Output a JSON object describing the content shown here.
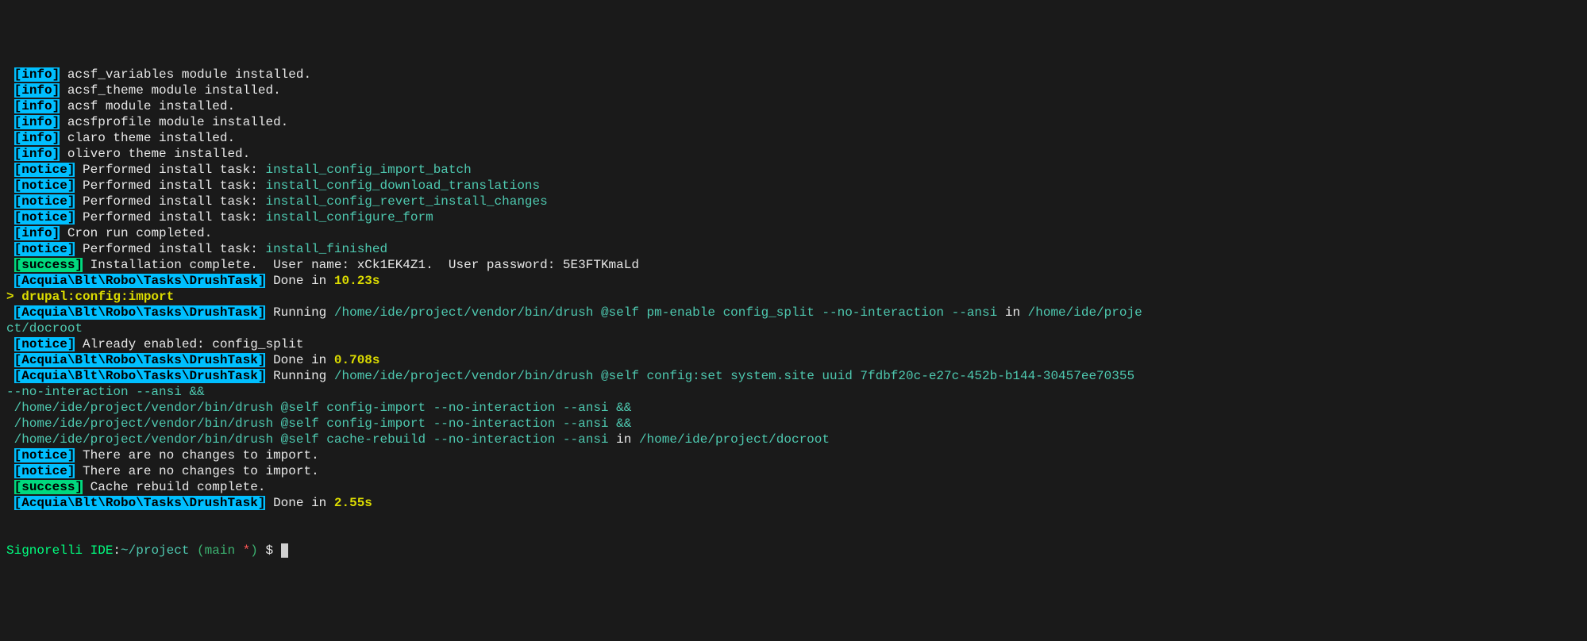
{
  "lines": [
    {
      "parts": [
        {
          "cls": "white",
          "text": " "
        },
        {
          "cls": "tag-info",
          "text": "[info]"
        },
        {
          "cls": "white",
          "text": " acsf_variables module installed."
        }
      ]
    },
    {
      "parts": [
        {
          "cls": "white",
          "text": " "
        },
        {
          "cls": "tag-info",
          "text": "[info]"
        },
        {
          "cls": "white",
          "text": " acsf_theme module installed."
        }
      ]
    },
    {
      "parts": [
        {
          "cls": "white",
          "text": " "
        },
        {
          "cls": "tag-info",
          "text": "[info]"
        },
        {
          "cls": "white",
          "text": " acsf module installed."
        }
      ]
    },
    {
      "parts": [
        {
          "cls": "white",
          "text": " "
        },
        {
          "cls": "tag-info",
          "text": "[info]"
        },
        {
          "cls": "white",
          "text": " acsfprofile module installed."
        }
      ]
    },
    {
      "parts": [
        {
          "cls": "white",
          "text": " "
        },
        {
          "cls": "tag-info",
          "text": "[info]"
        },
        {
          "cls": "white",
          "text": " claro theme installed."
        }
      ]
    },
    {
      "parts": [
        {
          "cls": "white",
          "text": " "
        },
        {
          "cls": "tag-info",
          "text": "[info]"
        },
        {
          "cls": "white",
          "text": " olivero theme installed."
        }
      ]
    },
    {
      "parts": [
        {
          "cls": "white",
          "text": " "
        },
        {
          "cls": "tag-notice",
          "text": "[notice]"
        },
        {
          "cls": "white",
          "text": " Performed install task: "
        },
        {
          "cls": "teal",
          "text": "install_config_import_batch"
        }
      ]
    },
    {
      "parts": [
        {
          "cls": "white",
          "text": " "
        },
        {
          "cls": "tag-notice",
          "text": "[notice]"
        },
        {
          "cls": "white",
          "text": " Performed install task: "
        },
        {
          "cls": "teal",
          "text": "install_config_download_translations"
        }
      ]
    },
    {
      "parts": [
        {
          "cls": "white",
          "text": " "
        },
        {
          "cls": "tag-notice",
          "text": "[notice]"
        },
        {
          "cls": "white",
          "text": " Performed install task: "
        },
        {
          "cls": "teal",
          "text": "install_config_revert_install_changes"
        }
      ]
    },
    {
      "parts": [
        {
          "cls": "white",
          "text": " "
        },
        {
          "cls": "tag-notice",
          "text": "[notice]"
        },
        {
          "cls": "white",
          "text": " Performed install task: "
        },
        {
          "cls": "teal",
          "text": "install_configure_form"
        }
      ]
    },
    {
      "parts": [
        {
          "cls": "white",
          "text": " "
        },
        {
          "cls": "tag-info",
          "text": "[info]"
        },
        {
          "cls": "white",
          "text": " Cron run completed."
        }
      ]
    },
    {
      "parts": [
        {
          "cls": "white",
          "text": " "
        },
        {
          "cls": "tag-notice",
          "text": "[notice]"
        },
        {
          "cls": "white",
          "text": " Performed install task: "
        },
        {
          "cls": "teal",
          "text": "install_finished"
        }
      ]
    },
    {
      "parts": [
        {
          "cls": "white",
          "text": " "
        },
        {
          "cls": "tag-success",
          "text": "[success]"
        },
        {
          "cls": "white",
          "text": " Installation complete.  User name: xCk1EK4Z1.  User password: 5E3FTKmaLd"
        }
      ]
    },
    {
      "parts": [
        {
          "cls": "white",
          "text": " "
        },
        {
          "cls": "tag-drush",
          "text": "[Acquia\\Blt\\Robo\\Tasks\\DrushTask]"
        },
        {
          "cls": "white",
          "text": " Done in "
        },
        {
          "cls": "yellow",
          "text": "10.23s"
        }
      ]
    },
    {
      "parts": [
        {
          "cls": "prompt-y",
          "text": "> drupal:config:import"
        }
      ]
    },
    {
      "parts": [
        {
          "cls": "white",
          "text": " "
        },
        {
          "cls": "tag-drush",
          "text": "[Acquia\\Blt\\Robo\\Tasks\\DrushTask]"
        },
        {
          "cls": "white",
          "text": " Running "
        },
        {
          "cls": "teal",
          "text": "/home/ide/project/vendor/bin/drush @self pm-enable config_split --no-interaction --ansi"
        },
        {
          "cls": "white",
          "text": " in "
        },
        {
          "cls": "teal",
          "text": "/home/ide/proje"
        }
      ]
    },
    {
      "parts": [
        {
          "cls": "teal",
          "text": "ct/docroot"
        }
      ]
    },
    {
      "parts": [
        {
          "cls": "white",
          "text": " "
        },
        {
          "cls": "tag-notice",
          "text": "[notice]"
        },
        {
          "cls": "white",
          "text": " Already enabled: config_split"
        }
      ]
    },
    {
      "parts": [
        {
          "cls": "white",
          "text": " "
        },
        {
          "cls": "tag-drush",
          "text": "[Acquia\\Blt\\Robo\\Tasks\\DrushTask]"
        },
        {
          "cls": "white",
          "text": " Done in "
        },
        {
          "cls": "yellow",
          "text": "0.708s"
        }
      ]
    },
    {
      "parts": [
        {
          "cls": "white",
          "text": " "
        },
        {
          "cls": "tag-drush",
          "text": "[Acquia\\Blt\\Robo\\Tasks\\DrushTask]"
        },
        {
          "cls": "white",
          "text": " Running "
        },
        {
          "cls": "teal",
          "text": "/home/ide/project/vendor/bin/drush @self config:set system.site uuid 7fdbf20c-e27c-452b-b144-30457ee70355 "
        }
      ]
    },
    {
      "parts": [
        {
          "cls": "teal",
          "text": "--no-interaction --ansi &&"
        }
      ]
    },
    {
      "parts": [
        {
          "cls": "teal",
          "text": " /home/ide/project/vendor/bin/drush @self config-import --no-interaction --ansi &&"
        }
      ]
    },
    {
      "parts": [
        {
          "cls": "teal",
          "text": " /home/ide/project/vendor/bin/drush @self config-import --no-interaction --ansi &&"
        }
      ]
    },
    {
      "parts": [
        {
          "cls": "teal",
          "text": " /home/ide/project/vendor/bin/drush @self cache-rebuild --no-interaction --ansi"
        },
        {
          "cls": "white",
          "text": " in "
        },
        {
          "cls": "teal",
          "text": "/home/ide/project/docroot"
        }
      ]
    },
    {
      "parts": [
        {
          "cls": "white",
          "text": " "
        },
        {
          "cls": "tag-notice",
          "text": "[notice]"
        },
        {
          "cls": "white",
          "text": " There are no changes to import."
        }
      ]
    },
    {
      "parts": [
        {
          "cls": "white",
          "text": " "
        },
        {
          "cls": "tag-notice",
          "text": "[notice]"
        },
        {
          "cls": "white",
          "text": " There are no changes to import."
        }
      ]
    },
    {
      "parts": [
        {
          "cls": "white",
          "text": " "
        },
        {
          "cls": "tag-success",
          "text": "[success]"
        },
        {
          "cls": "white",
          "text": " Cache rebuild complete."
        }
      ]
    },
    {
      "parts": [
        {
          "cls": "white",
          "text": " "
        },
        {
          "cls": "tag-drush",
          "text": "[Acquia\\Blt\\Robo\\Tasks\\DrushTask]"
        },
        {
          "cls": "white",
          "text": " Done in "
        },
        {
          "cls": "yellow",
          "text": "2.55s"
        }
      ]
    }
  ],
  "prompt": {
    "host": "Signorelli IDE",
    "sep": ":",
    "path": "~/project",
    "branch_open": " (",
    "branch": "main",
    "dirty": " *",
    "branch_close": ")",
    "symbol": " $ "
  }
}
